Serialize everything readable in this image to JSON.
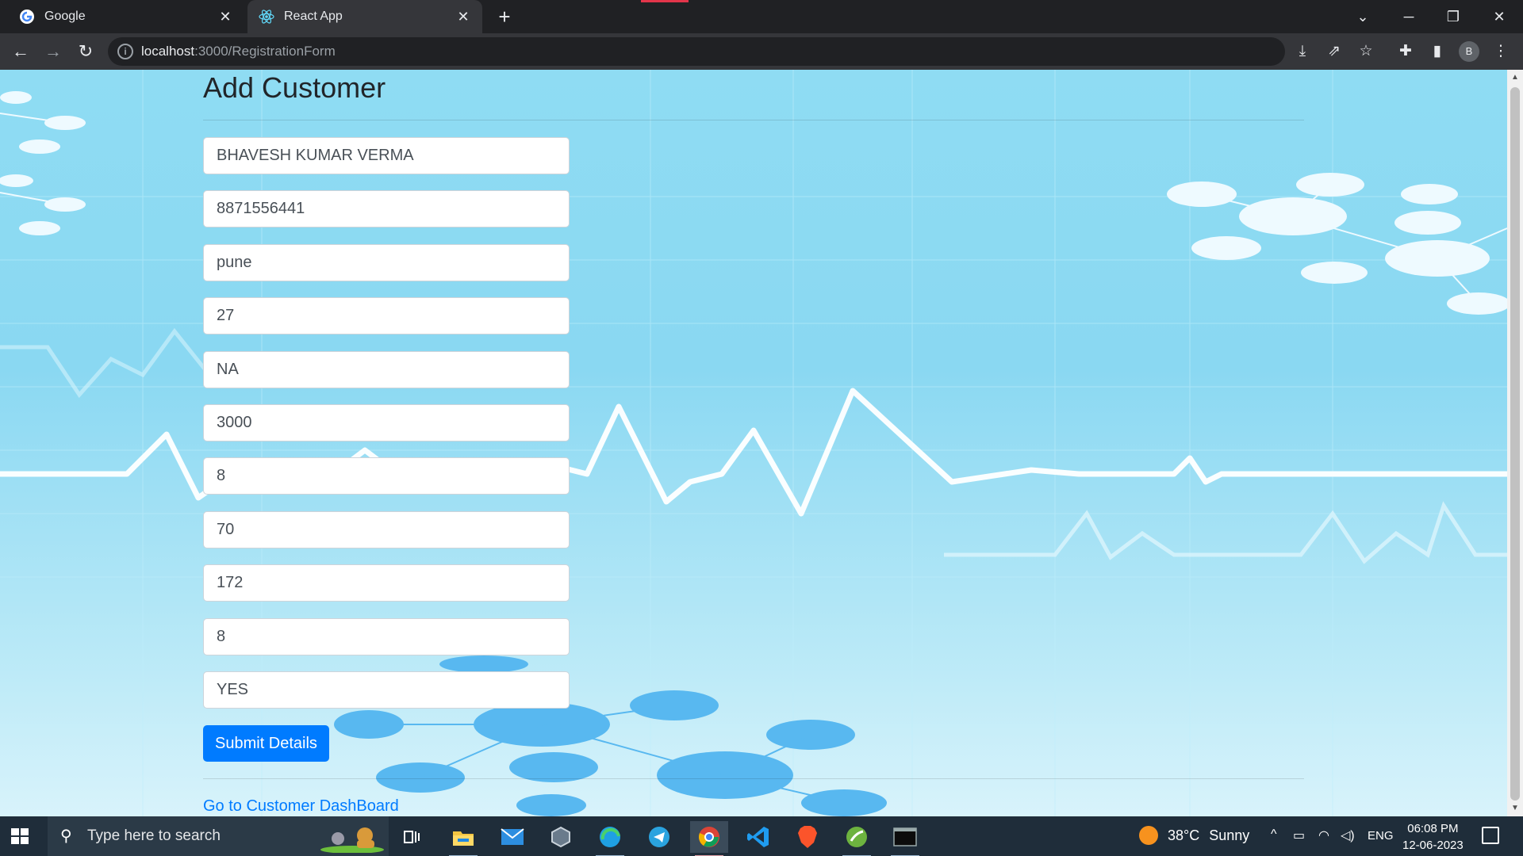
{
  "browser": {
    "tabs": [
      {
        "title": "Google",
        "active": false,
        "icon": "google-g-icon"
      },
      {
        "title": "React App",
        "active": true,
        "icon": "react-atom-icon"
      }
    ],
    "url_host": "localhost",
    "url_path": ":3000/RegistrationForm",
    "profile_initial": "B"
  },
  "page": {
    "title": "Add Customer",
    "fields": [
      {
        "name": "name-field",
        "value": "BHAVESH KUMAR VERMA"
      },
      {
        "name": "phone-field",
        "value": "8871556441"
      },
      {
        "name": "city-field",
        "value": "pune"
      },
      {
        "name": "age-field",
        "value": "27"
      },
      {
        "name": "condition-field",
        "value": "NA"
      },
      {
        "name": "amount-field",
        "value": "3000"
      },
      {
        "name": "field-7",
        "value": "8"
      },
      {
        "name": "weight-field",
        "value": "70"
      },
      {
        "name": "height-field",
        "value": "172"
      },
      {
        "name": "field-10",
        "value": "8"
      },
      {
        "name": "field-11",
        "value": "YES"
      }
    ],
    "submit_label": "Submit Details",
    "dashboard_link": "Go to Customer DashBoard"
  },
  "taskbar": {
    "search_placeholder": "Type here to search",
    "weather_temp": "38°C",
    "weather_desc": "Sunny",
    "language": "ENG",
    "time": "06:08 PM",
    "date": "12-06-2023",
    "apps": [
      "task-view-icon",
      "file-explorer-icon",
      "mail-icon",
      "settings-cube-icon",
      "edge-icon",
      "telegram-icon",
      "chrome-icon",
      "vscode-icon",
      "brave-icon",
      "spring-icon",
      "terminal-icon"
    ]
  },
  "colors": {
    "primary": "#007bff",
    "chrome_dark": "#202124",
    "chrome_toolbar": "#35363a",
    "taskbar": "#1f2d3a"
  }
}
